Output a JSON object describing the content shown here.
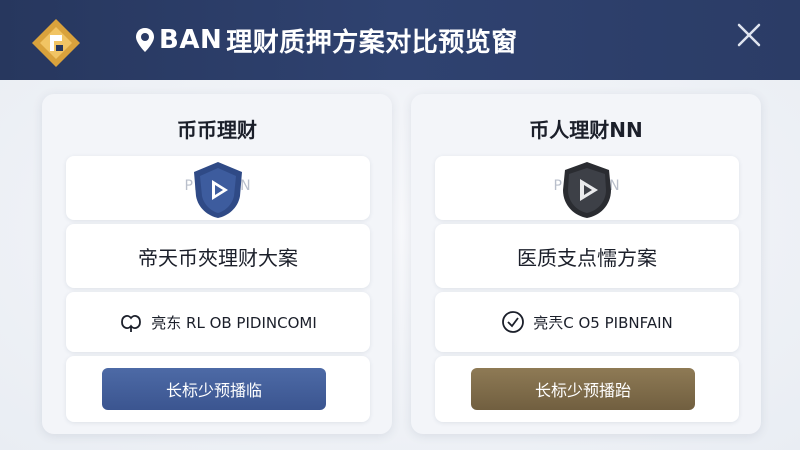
{
  "header": {
    "title_prefix": "BAN",
    "title_text": "理财质押方案对比预览窗",
    "logo_icon": "diamond-logo-icon",
    "close_icon": "close-icon"
  },
  "colors": {
    "header_bg": "#2b3c66",
    "left_button": "#4561a0",
    "right_button": "#80704c"
  },
  "panels": [
    {
      "title": "币币理财",
      "brand_watermark": "PEL        DAN",
      "badge_icon": "blue-shield-play-icon",
      "plan": "帝天币夾理财大案",
      "feature_icon": "wave-icon",
      "feature_text": "亮东 RL OB PIDINCOMI",
      "button_label": "长标少预播临"
    },
    {
      "title": "币人理财NN",
      "brand_watermark": "PEL          DAN",
      "badge_icon": "dark-shield-play-icon",
      "plan": "医质支点懦方案",
      "feature_icon": "check-circle-icon",
      "feature_text": "亮兲C O5 PIBNFAIN",
      "button_label": "长标少预播跆"
    }
  ]
}
